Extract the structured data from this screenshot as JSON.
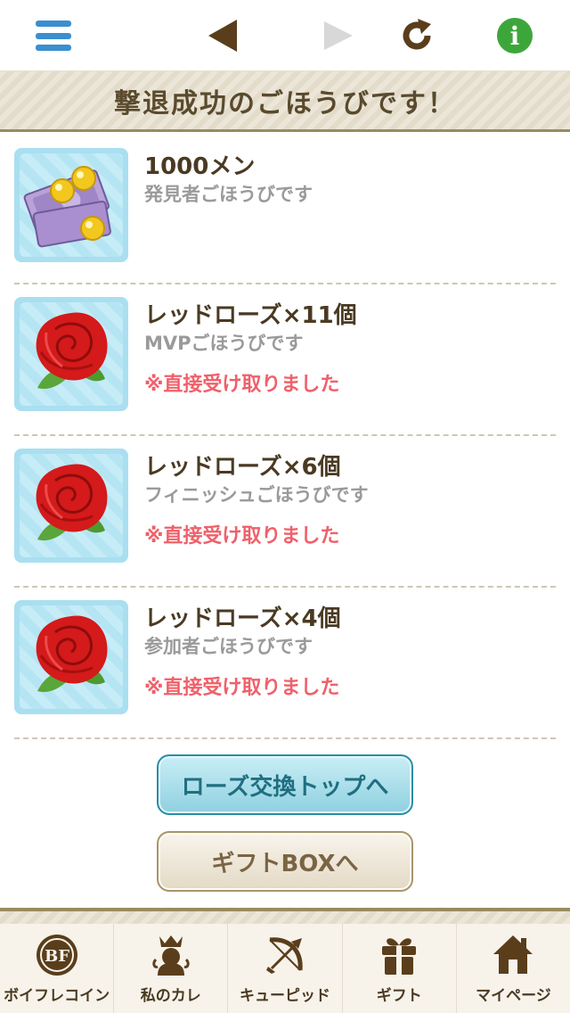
{
  "toolbar": {
    "menu_icon": "hamburger-menu-icon",
    "back_icon": "back-arrow-icon",
    "forward_icon": "forward-arrow-icon",
    "reload_icon": "reload-icon",
    "info_icon": "info-icon",
    "info_glyph": "i",
    "colors": {
      "menu": "#3a8fd0",
      "nav_active": "#5a3e1c",
      "nav_disabled": "#d8d8d8",
      "info": "#3da63b"
    }
  },
  "banner": {
    "title": "撃退成功のごほうびです！"
  },
  "rewards": [
    {
      "icon": "money-coins-icon",
      "name": "1000メン",
      "description": "発見者ごほうびです",
      "status": ""
    },
    {
      "icon": "red-rose-icon",
      "name": "レッドローズ×11個",
      "description": "MVPごほうびです",
      "status": "※直接受け取りました"
    },
    {
      "icon": "red-rose-icon",
      "name": "レッドローズ×6個",
      "description": "フィニッシュごほうびです",
      "status": "※直接受け取りました"
    },
    {
      "icon": "red-rose-icon",
      "name": "レッドローズ×4個",
      "description": "参加者ごほうびです",
      "status": "※直接受け取りました"
    }
  ],
  "buttons": {
    "rose_exchange": "ローズ交換トップへ",
    "gift_box": "ギフトBOXへ"
  },
  "bottom_nav": [
    {
      "label": "ボイフレコイン",
      "icon": "bf-coin-icon",
      "glyph": "BF"
    },
    {
      "label": "私のカレ",
      "icon": "crowned-boyfriend-icon"
    },
    {
      "label": "キューピッド",
      "icon": "cupid-bow-icon"
    },
    {
      "label": "ギフト",
      "icon": "gift-box-icon"
    },
    {
      "label": "マイページ",
      "icon": "home-icon"
    }
  ]
}
